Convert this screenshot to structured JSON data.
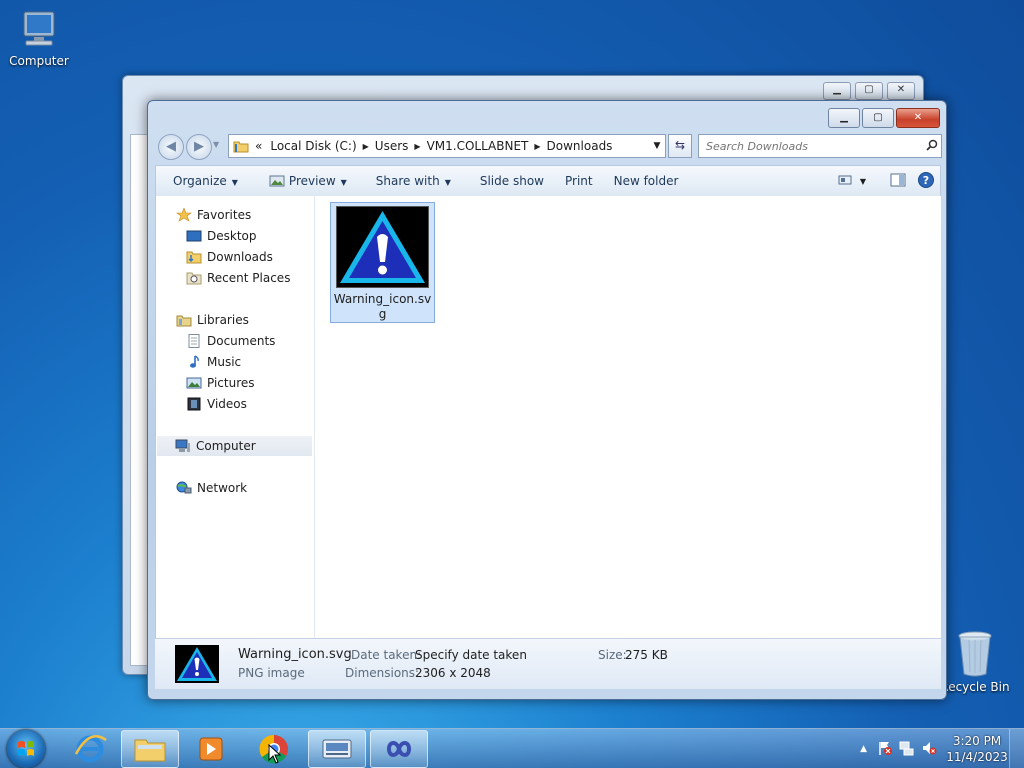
{
  "desktop": {
    "computer_label": "Computer",
    "recycle_label": "Recycle Bin"
  },
  "window": {
    "address": {
      "overflow": "«",
      "crumbs": [
        "Local Disk (C:)",
        "Users",
        "VM1.COLLABNET",
        "Downloads"
      ]
    },
    "search_placeholder": "Search Downloads",
    "toolbar": {
      "organize": "Organize",
      "preview": "Preview",
      "share_with": "Share with",
      "slide_show": "Slide show",
      "print": "Print",
      "new_folder": "New folder"
    },
    "nav": {
      "favorites": "Favorites",
      "desktop": "Desktop",
      "downloads": "Downloads",
      "recent_places": "Recent Places",
      "libraries": "Libraries",
      "documents": "Documents",
      "music": "Music",
      "pictures": "Pictures",
      "videos": "Videos",
      "computer": "Computer",
      "network": "Network"
    },
    "file": {
      "name": "Warning_icon.svg"
    },
    "details": {
      "name": "Warning_icon.svg",
      "type": "PNG image",
      "date_label": "Date taken:",
      "date_value": "Specify date taken",
      "dim_label": "Dimensions:",
      "dim_value": "2306 x 2048",
      "size_label": "Size:",
      "size_value": "275 KB"
    }
  },
  "taskbar": {
    "time": "3:20 PM",
    "date": "11/4/2023"
  },
  "colors": {
    "accent": "#1c7fce",
    "selection": "#cfe3fb",
    "close_button": "#c8412a"
  }
}
